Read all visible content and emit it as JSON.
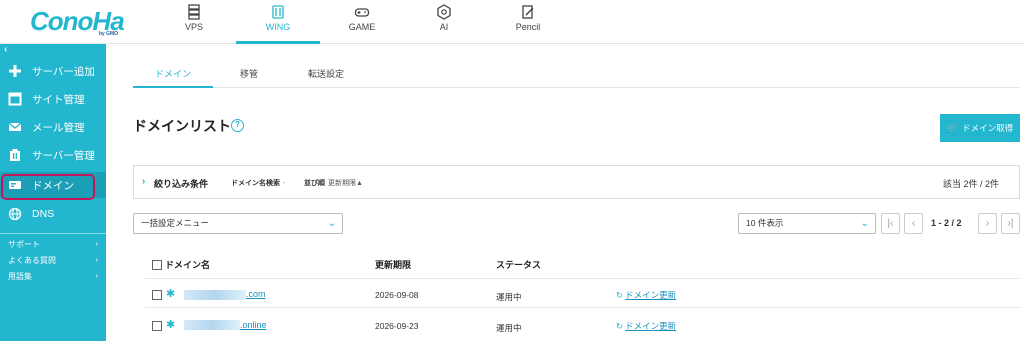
{
  "header": {
    "logo_text": "ConoHa",
    "logo_sub": "by GMO",
    "tabs": [
      {
        "label": "VPS",
        "icon": "server-icon"
      },
      {
        "label": "WING",
        "icon": "wing-icon"
      },
      {
        "label": "GAME",
        "icon": "gamepad-icon"
      },
      {
        "label": "AI",
        "icon": "ai-icon"
      },
      {
        "label": "Pencil",
        "icon": "pencil-icon"
      }
    ],
    "active_tab": "WING"
  },
  "sidebar": {
    "collapse": "‹",
    "items": [
      {
        "label": "サーバー追加",
        "icon": "plus-icon"
      },
      {
        "label": "サイト管理",
        "icon": "window-icon"
      },
      {
        "label": "メール管理",
        "icon": "mail-icon"
      },
      {
        "label": "サーバー管理",
        "icon": "server-manage-icon"
      },
      {
        "label": "ドメイン",
        "icon": "domain-icon"
      },
      {
        "label": "DNS",
        "icon": "globe-icon"
      }
    ],
    "active_item": "ドメイン",
    "sub_links": [
      {
        "label": "サポート",
        "arrow": "›"
      },
      {
        "label": "よくある質問",
        "arrow": "›"
      },
      {
        "label": "用語集",
        "arrow": "›"
      }
    ]
  },
  "main": {
    "subtabs": [
      "ドメイン",
      "移管",
      "転送設定"
    ],
    "active_subtab": "ドメイン",
    "title": "ドメインリスト",
    "help": "?",
    "buy_button": "ドメイン取得",
    "filter": {
      "toggle": "›",
      "title": "絞り込み条件",
      "search_label": "ドメイン名検索",
      "search_caret": "-",
      "sort_label": "並び順",
      "sort_value": "更新期限▲",
      "count": "該当 2件 / 2件"
    },
    "bulk_menu": "一括設定メニュー",
    "per_page": "10 件表示",
    "pagination": {
      "first": "|‹",
      "prev": "‹",
      "info": "1 - 2 / 2",
      "next": "›",
      "last": "›|"
    },
    "table": {
      "headers": [
        "ドメイン名",
        "更新期限",
        "ステータス"
      ],
      "rows": [
        {
          "domain": ".com",
          "expiry": "2026-09-08",
          "status": "運用中",
          "action": "ドメイン更新"
        },
        {
          "domain": ".online",
          "expiry": "2026-09-23",
          "status": "運用中",
          "action": "ドメイン更新"
        }
      ]
    }
  },
  "colors": {
    "accent": "#23b6cf",
    "highlight": "#c2185b",
    "link": "#1a8fc0"
  }
}
